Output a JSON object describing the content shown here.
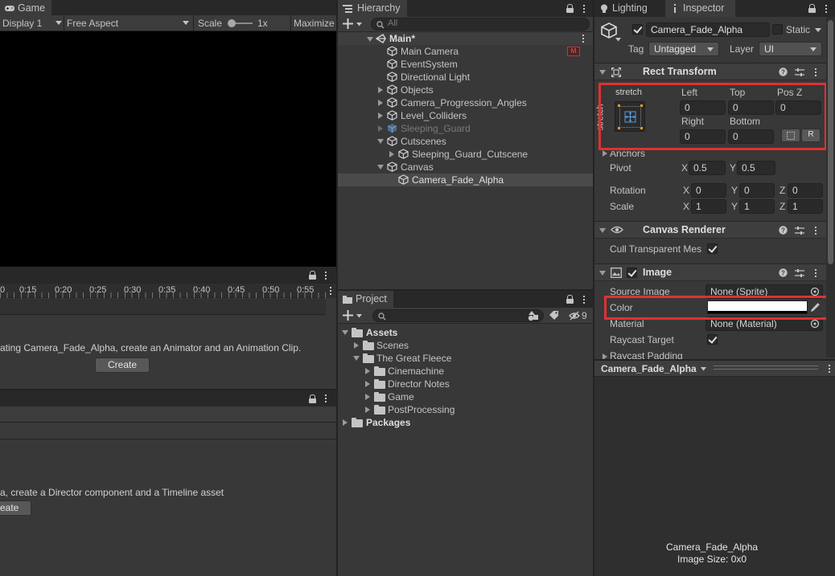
{
  "game": {
    "tab_label": "Game",
    "display": "Display 1",
    "aspect": "Free Aspect",
    "scale_label": "Scale",
    "scale_value": "1x",
    "maximize": "Maximize"
  },
  "animation": {
    "ticks": [
      "0",
      "0:15",
      "0:20",
      "0:25",
      "0:30",
      "0:35",
      "0:40",
      "0:45",
      "0:50",
      "0:55"
    ],
    "message": "ating Camera_Fade_Alpha, create an Animator and an Animation Clip.",
    "create_label": "Create"
  },
  "timeline": {
    "message": "a, create a Director component and a Timeline asset",
    "create_label": "eate"
  },
  "hierarchy": {
    "tab_label": "Hierarchy",
    "search_placeholder": "All",
    "scene": "Main*",
    "items": [
      {
        "label": "Main Camera"
      },
      {
        "label": "EventSystem"
      },
      {
        "label": "Directional Light"
      },
      {
        "label": "Objects"
      },
      {
        "label": "Camera_Progression_Angles"
      },
      {
        "label": "Level_Colliders"
      },
      {
        "label": "Sleeping_Guard"
      },
      {
        "label": "Cutscenes"
      },
      {
        "label": "Sleeping_Guard_Cutscene"
      },
      {
        "label": "Canvas"
      },
      {
        "label": "Camera_Fade_Alpha"
      }
    ]
  },
  "project": {
    "tab_label": "Project",
    "hidden_count": "9",
    "tree": [
      {
        "label": "Assets"
      },
      {
        "label": "Scenes"
      },
      {
        "label": "The Great Fleece"
      },
      {
        "label": "Cinemachine"
      },
      {
        "label": "Director Notes"
      },
      {
        "label": "Game"
      },
      {
        "label": "PostProcessing"
      },
      {
        "label": "Packages"
      }
    ]
  },
  "inspector": {
    "lighting_tab": "Lighting",
    "inspector_tab": "Inspector",
    "object_name": "Camera_Fade_Alpha",
    "static_label": "Static",
    "tag_label": "Tag",
    "tag_value": "Untagged",
    "layer_label": "Layer",
    "layer_value": "UI",
    "rect_transform": {
      "title": "Rect Transform",
      "anchor_top": "stretch",
      "anchor_side": "stretch",
      "left_label": "Left",
      "left_value": "0",
      "top_label": "Top",
      "top_value": "0",
      "posz_label": "Pos Z",
      "posz_value": "0",
      "right_label": "Right",
      "right_value": "0",
      "bottom_label": "Bottom",
      "bottom_value": "0",
      "r_button": "R",
      "anchors_label": "Anchors",
      "pivot_label": "Pivot",
      "pivot_x": "0.5",
      "pivot_y": "0.5",
      "rotation_label": "Rotation",
      "rot_x": "0",
      "rot_y": "0",
      "rot_z": "0",
      "scale_label": "Scale",
      "scale_x": "1",
      "scale_y": "1",
      "scale_z": "1",
      "x": "X",
      "y": "Y",
      "z": "Z"
    },
    "canvas_renderer": {
      "title": "Canvas Renderer",
      "cull_label": "Cull Transparent Mes"
    },
    "image": {
      "title": "Image",
      "source_label": "Source Image",
      "source_value": "None (Sprite)",
      "color_label": "Color",
      "material_label": "Material",
      "material_value": "None (Material)",
      "raycast_label": "Raycast Target",
      "padding_label": "Raycast Padding"
    },
    "preview": {
      "dropdown": "Camera_Fade_Alpha",
      "name": "Camera_Fade_Alpha",
      "size": "Image Size: 0x0"
    }
  },
  "colors": {
    "highlight": "#e03131",
    "panel": "#383838",
    "selected_row": "#4a4a4a"
  }
}
